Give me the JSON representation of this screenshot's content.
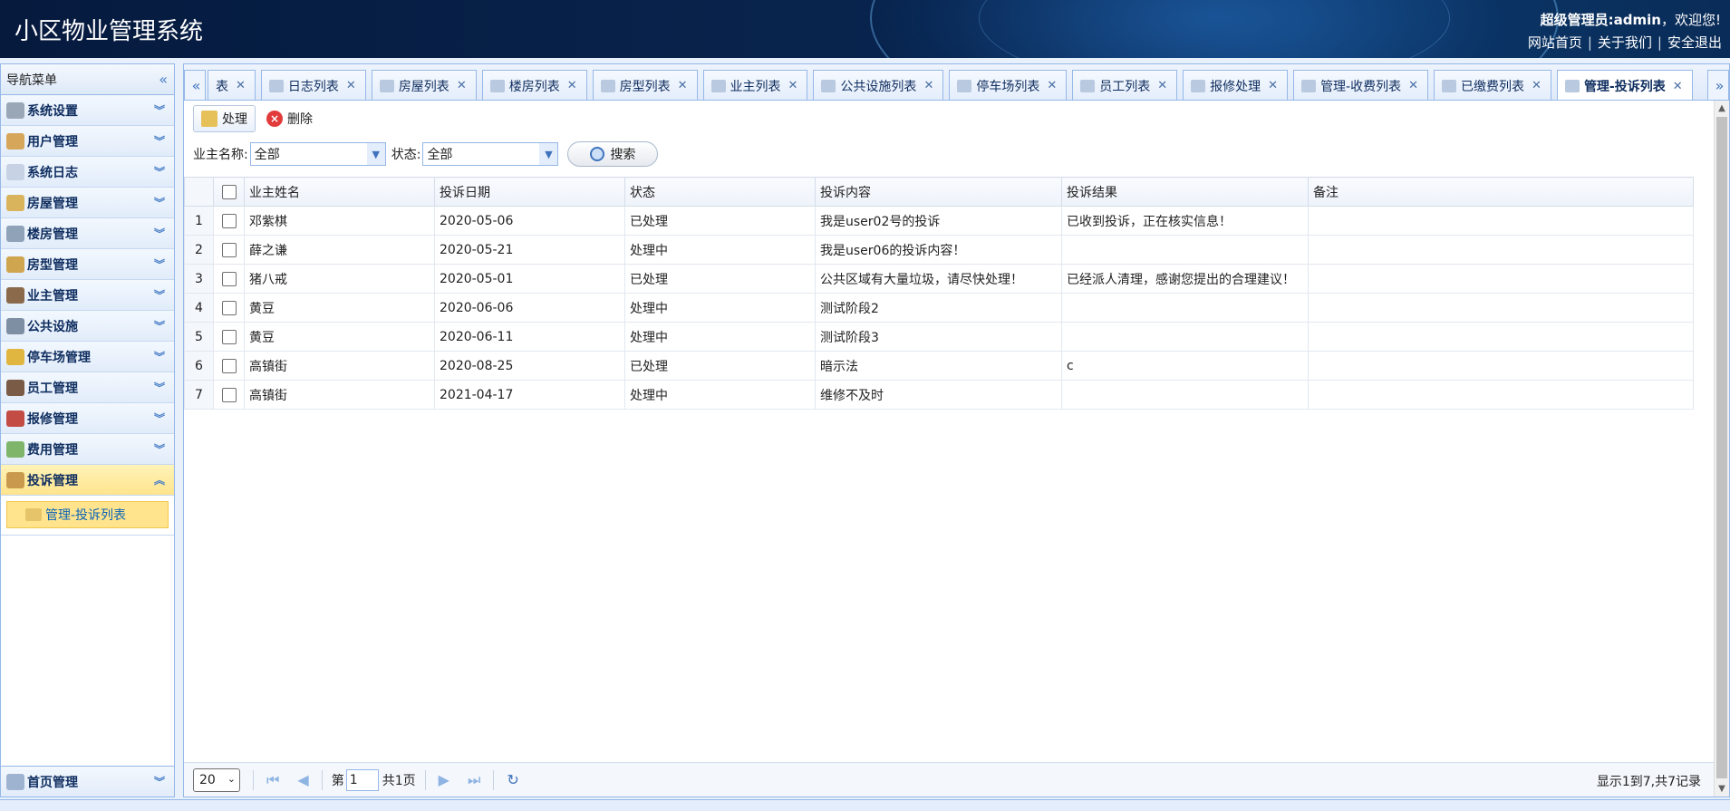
{
  "header": {
    "title": "小区物业管理系统",
    "user_role": "超级管理员:admin",
    "welcome": "，欢迎您!",
    "links": [
      "网站首页",
      "关于我们",
      "安全退出"
    ],
    "separator": "|"
  },
  "nav": {
    "title": "导航菜单",
    "items": [
      {
        "label": "系统设置",
        "icon": "gear-icon",
        "color": "#9aa7b7"
      },
      {
        "label": "用户管理",
        "icon": "users-icon",
        "color": "#d6a75a"
      },
      {
        "label": "系统日志",
        "icon": "log-icon",
        "color": "#c7d3e4"
      },
      {
        "label": "房屋管理",
        "icon": "house-icon",
        "color": "#d9b45d"
      },
      {
        "label": "楼房管理",
        "icon": "building-icon",
        "color": "#8fa2b8"
      },
      {
        "label": "房型管理",
        "icon": "house-type-icon",
        "color": "#cfa64f"
      },
      {
        "label": "业主管理",
        "icon": "owner-icon",
        "color": "#8a6a4b"
      },
      {
        "label": "公共设施",
        "icon": "tools-icon",
        "color": "#7f8fa3"
      },
      {
        "label": "停车场管理",
        "icon": "key-icon",
        "color": "#e0b640"
      },
      {
        "label": "员工管理",
        "icon": "employee-icon",
        "color": "#7a5b45"
      },
      {
        "label": "报修管理",
        "icon": "repair-icon",
        "color": "#c34d45"
      },
      {
        "label": "费用管理",
        "icon": "money-icon",
        "color": "#7fb56a"
      },
      {
        "label": "投诉管理",
        "icon": "complaint-icon",
        "color": "#c99a4d"
      }
    ],
    "sub_item": "管理-投诉列表",
    "bottom_item": "首页管理"
  },
  "tabs": [
    {
      "label": "表",
      "icon": "list-icon"
    },
    {
      "label": "日志列表",
      "icon": "log-icon"
    },
    {
      "label": "房屋列表",
      "icon": "house-icon"
    },
    {
      "label": "楼房列表",
      "icon": "building-icon"
    },
    {
      "label": "房型列表",
      "icon": "house-type-icon"
    },
    {
      "label": "业主列表",
      "icon": "owner-icon"
    },
    {
      "label": "公共设施列表",
      "icon": "grid-icon"
    },
    {
      "label": "停车场列表",
      "icon": "grid-icon"
    },
    {
      "label": "员工列表",
      "icon": "employee-icon"
    },
    {
      "label": "报修处理",
      "icon": "grid-icon"
    },
    {
      "label": "管理-收费列表",
      "icon": "grid-icon"
    },
    {
      "label": "已缴费列表",
      "icon": "edit-icon"
    },
    {
      "label": "管理-投诉列表",
      "icon": "complaint-icon",
      "active": true
    }
  ],
  "toolbar": {
    "process": "处理",
    "delete": "删除"
  },
  "filter": {
    "owner_label": "业主名称:",
    "owner_value": "全部",
    "status_label": "状态:",
    "status_value": "全部",
    "search": "搜索"
  },
  "table": {
    "columns": [
      "业主姓名",
      "投诉日期",
      "状态",
      "投诉内容",
      "投诉结果",
      "备注"
    ],
    "rows": [
      {
        "n": "1",
        "name": "邓紫棋",
        "date": "2020-05-06",
        "status": "已处理",
        "content": "我是user02号的投诉",
        "result": "已收到投诉，正在核实信息！",
        "note": ""
      },
      {
        "n": "2",
        "name": "薛之谦",
        "date": "2020-05-21",
        "status": "处理中",
        "content": "我是user06的投诉内容！",
        "result": "",
        "note": ""
      },
      {
        "n": "3",
        "name": "猪八戒",
        "date": "2020-05-01",
        "status": "已处理",
        "content": "公共区域有大量垃圾，请尽快处理！",
        "result": "已经派人清理，感谢您提出的合理建议！",
        "note": ""
      },
      {
        "n": "4",
        "name": "黄豆",
        "date": "2020-06-06",
        "status": "处理中",
        "content": "测试阶段2",
        "result": "",
        "note": ""
      },
      {
        "n": "5",
        "name": "黄豆",
        "date": "2020-06-11",
        "status": "处理中",
        "content": "测试阶段3",
        "result": "",
        "note": ""
      },
      {
        "n": "6",
        "name": "高镇街",
        "date": "2020-08-25",
        "status": "已处理",
        "content": "暗示法",
        "result": "c",
        "note": ""
      },
      {
        "n": "7",
        "name": "高镇街",
        "date": "2021-04-17",
        "status": "处理中",
        "content": "维修不及时",
        "result": "",
        "note": ""
      }
    ]
  },
  "pager": {
    "page_size": "20",
    "page_prefix": "第",
    "page_value": "1",
    "page_suffix": "共1页",
    "info": "显示1到7,共7记录"
  }
}
